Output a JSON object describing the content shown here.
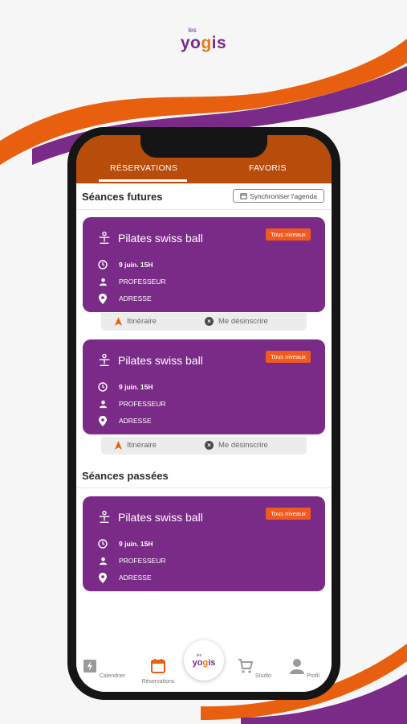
{
  "brand": {
    "prefix": "les",
    "name_start": "yo",
    "name_o": "g",
    "name_end": "is"
  },
  "tabs": {
    "reservations": "RÉSERVATIONS",
    "favorites": "FAVORIS"
  },
  "sections": {
    "future": "Séances futures",
    "past": "Séances passées"
  },
  "sync_button": {
    "label": "Synchroniser l'agenda",
    "icon": "calendar-icon"
  },
  "cards": [
    {
      "title": "Pilates swiss ball",
      "badge": "Tous niveaux",
      "date": "9 juin. 15H",
      "teacher": "PROFESSEUR",
      "address": "ADRESSE"
    },
    {
      "title": "Pilates swiss ball",
      "badge": "Tous niveaux",
      "date": "9 juin. 15H",
      "teacher": "PROFESSEUR",
      "address": "ADRESSE"
    },
    {
      "title": "Pilates swiss ball",
      "badge": "Tous niveaux",
      "date": "9 juin. 15H",
      "teacher": "PROFESSEUR",
      "address": "ADRESSE"
    }
  ],
  "actions": {
    "itinerary": "Itinéraire",
    "unsubscribe": "Me désinscrire"
  },
  "bottom_nav": {
    "calendar": "Calendrier",
    "reservations": "Réservations",
    "studio": "Studio",
    "profile": "Profil"
  },
  "colors": {
    "purple": "#7a2a87",
    "orange": "#b84c0b",
    "badge": "#f05a1e"
  }
}
